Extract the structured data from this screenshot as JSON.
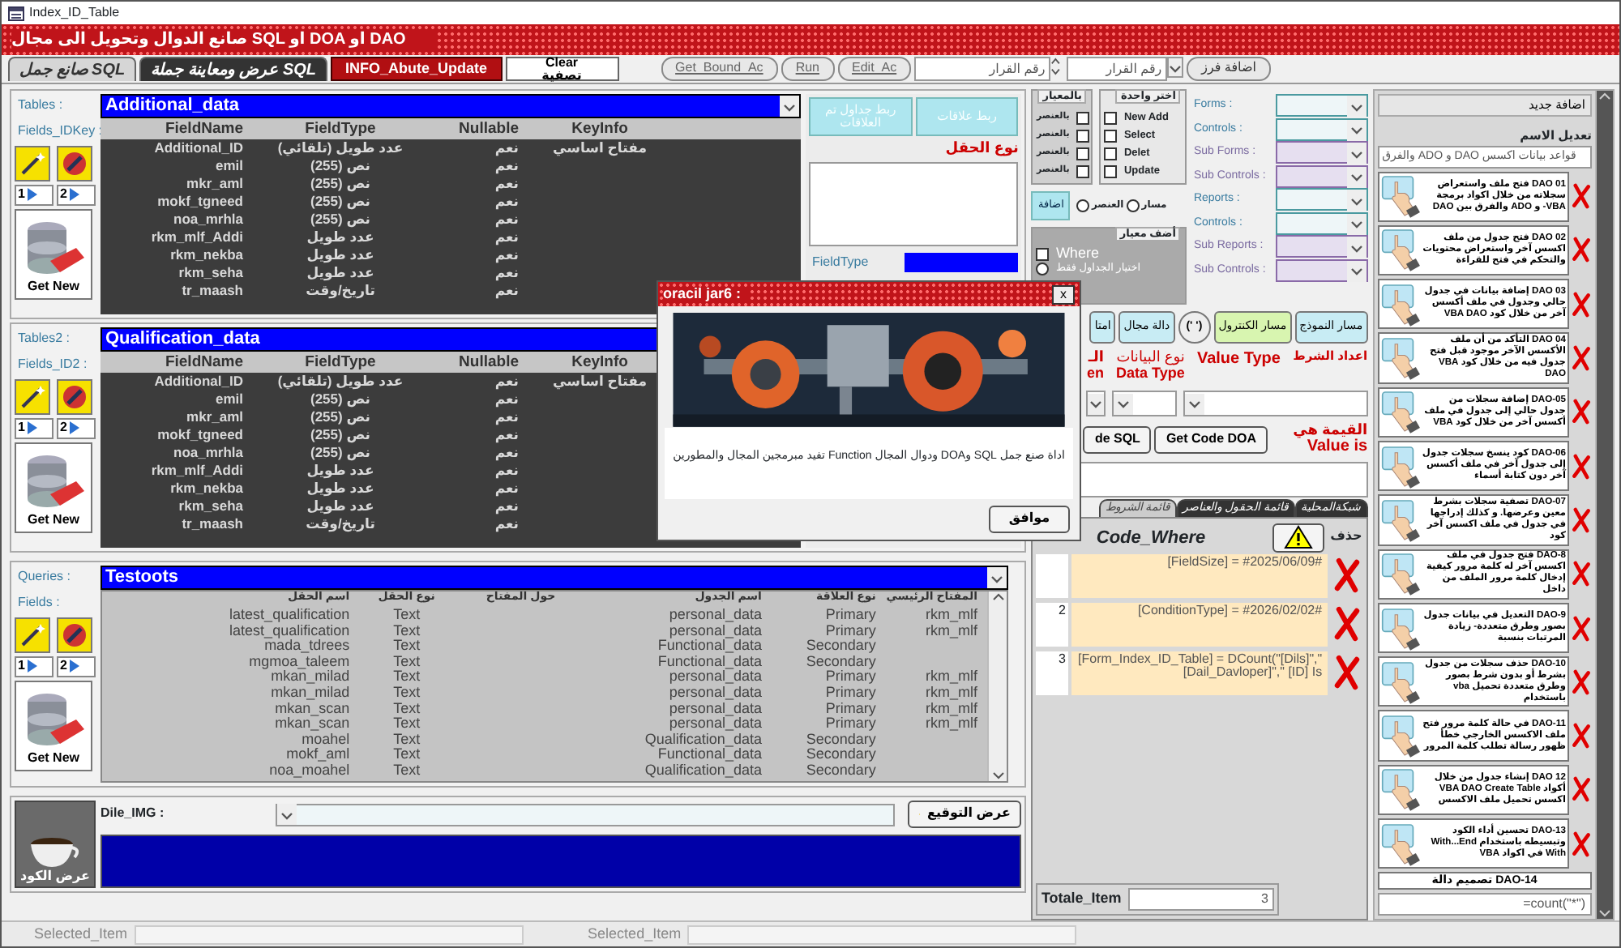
{
  "window": {
    "title": "Index_ID_Table"
  },
  "banner": {
    "title": "صانع الدوال وتحويل الى مجال SQL او DOA او DAO"
  },
  "toolbar": {
    "tabs": [
      {
        "label": "عرض ومعاينة جملة SQL",
        "selected": false
      },
      {
        "label": "صانع جمل SQL",
        "selected": true
      }
    ],
    "info_button": "INFO_Abute_Update",
    "clear_button": {
      "line_1": "Clear",
      "line_2": "تصفية"
    },
    "action_buttons": [
      "Edit_Ac",
      "Run",
      "Get_Bound_Ac"
    ],
    "number_spinner": {
      "placeholder": "رقم القرار"
    },
    "number_combo": {
      "placeholder": "رقم القرار"
    },
    "sort_button": "اضافة فرز"
  },
  "table_panels": [
    {
      "tables_label": "Tables :",
      "fields_label": "Fields_IDKey :",
      "table": "Additional_data",
      "columns": [
        "KeyInfo",
        "Nullable",
        "FieldType",
        "FieldName"
      ],
      "nav_buttons": [
        "2",
        "1"
      ],
      "get_new_button": "Get New",
      "rows": [
        {
          "key_info": "مفتاح اساسي",
          "nullable": "نعم",
          "field_type": "عدد طويل (تلقائي)",
          "field_name": "Additional_ID"
        },
        {
          "nullable": "نعم",
          "field_type": "نص (255)",
          "field_name": "emil"
        },
        {
          "nullable": "نعم",
          "field_type": "نص (255)",
          "field_name": "mkr_aml"
        },
        {
          "nullable": "نعم",
          "field_type": "نص (255)",
          "field_name": "mokf_tgneed"
        },
        {
          "nullable": "نعم",
          "field_type": "نص (255)",
          "field_name": "noa_mrhla"
        },
        {
          "nullable": "نعم",
          "field_type": "عدد طويل",
          "field_name": "rkm_mlf_Addi"
        },
        {
          "nullable": "نعم",
          "field_type": "عدد طويل",
          "field_name": "rkm_nekba"
        },
        {
          "nullable": "نعم",
          "field_type": "عدد طويل",
          "field_name": "rkm_seha"
        },
        {
          "nullable": "نعم",
          "field_type": "تاريخ/وقت",
          "field_name": "tr_maash"
        }
      ]
    },
    {
      "tables_label": "Tables2 :",
      "fields_label": "Fields_ID2 :",
      "table": "Qualification_data",
      "columns": [
        "KeyInfo",
        "Nullable",
        "FieldType",
        "FieldName"
      ],
      "nav_buttons": [
        "2",
        "1"
      ],
      "get_new_button": "Get New",
      "rows": [
        {
          "key_info": "مفتاح اساسي",
          "nullable": "نعم",
          "field_type": "عدد طويل (تلقائي)",
          "field_name": "Additional_ID"
        },
        {
          "nullable": "نعم",
          "field_type": "نص (255)",
          "field_name": "emil"
        },
        {
          "nullable": "نعم",
          "field_type": "نص (255)",
          "field_name": "mkr_aml"
        },
        {
          "nullable": "نعم",
          "field_type": "نص (255)",
          "field_name": "mokf_tgneed"
        },
        {
          "nullable": "نعم",
          "field_type": "نص (255)",
          "field_name": "noa_mrhla"
        },
        {
          "nullable": "نعم",
          "field_type": "عدد طويل",
          "field_name": "rkm_mlf_Addi"
        },
        {
          "nullable": "نعم",
          "field_type": "عدد طويل",
          "field_name": "rkm_nekba"
        },
        {
          "nullable": "نعم",
          "field_type": "عدد طويل",
          "field_name": "rkm_seha"
        },
        {
          "nullable": "نعم",
          "field_type": "تاريخ/وقت",
          "field_name": "tr_maash"
        }
      ]
    }
  ],
  "relations": {
    "buttons": [
      {
        "label": "ربط علاقات",
        "disabled": true
      },
      {
        "label": "ربط جداول تم العلاقات",
        "disabled": true
      }
    ],
    "field_type_title": "نوع الحقل",
    "field_type_label": "FieldType"
  },
  "query_panel": {
    "queries_label": "Queries :",
    "fields_label": "Fields :",
    "query": "Testoots",
    "nav_buttons": [
      "2",
      "1"
    ],
    "get_new_button": "Get New",
    "columns": [
      "المفتاح الرئيسي",
      "نوع العلاقة",
      "اسم الجدول",
      "حول المفتاح",
      "نوع الحقل",
      "اسم الحقل"
    ],
    "rows": [
      {
        "primary_key": "rkm_mlf",
        "relation": "Primary",
        "table_name": "personal_data",
        "field_type": "Text",
        "field_name": "latest_qualification"
      },
      {
        "primary_key": "rkm_mlf",
        "relation": "Primary",
        "table_name": "personal_data",
        "field_type": "Text",
        "field_name": "latest_qualification"
      },
      {
        "relation": "Secondary",
        "table_name": "Functional_data",
        "field_type": "Text",
        "field_name": "mada_tdrees"
      },
      {
        "relation": "Secondary",
        "table_name": "Functional_data",
        "field_type": "Text",
        "field_name": "mgmoa_taleem"
      },
      {
        "primary_key": "rkm_mlf",
        "relation": "Primary",
        "table_name": "personal_data",
        "field_type": "Text",
        "field_name": "mkan_milad"
      },
      {
        "primary_key": "rkm_mlf",
        "relation": "Primary",
        "table_name": "personal_data",
        "field_type": "Text",
        "field_name": "mkan_milad"
      },
      {
        "primary_key": "rkm_mlf",
        "relation": "Primary",
        "table_name": "personal_data",
        "field_type": "Text",
        "field_name": "mkan_scan"
      },
      {
        "primary_key": "rkm_mlf",
        "relation": "Primary",
        "table_name": "personal_data",
        "field_type": "Text",
        "field_name": "mkan_scan"
      },
      {
        "relation": "Secondary",
        "table_name": "Qualification_data",
        "field_type": "Text",
        "field_name": "moahel"
      },
      {
        "relation": "Secondary",
        "table_name": "Functional_data",
        "field_type": "Text",
        "field_name": "mokf_aml"
      },
      {
        "relation": "Secondary",
        "table_name": "Qualification_data",
        "field_type": "Text",
        "field_name": "noa_moahel"
      }
    ]
  },
  "image_panel": {
    "label": "Dile_IMG :",
    "show_signature_button": "عرض التوقيع",
    "show_code_button": "عرض الكود"
  },
  "criteria": {
    "by_criteria_title": "بالمعيار",
    "by_criteria": [
      {
        "label": "بالعنصر",
        "checked": false
      },
      {
        "label": "بالعنصر",
        "checked": false
      },
      {
        "label": "بالعنصر",
        "checked": false
      },
      {
        "label": "بالعنصر",
        "checked": false
      }
    ],
    "choose_one_title": "اختر واحدة",
    "choose_one": [
      {
        "label": "New Add",
        "checked": false
      },
      {
        "label": "Select",
        "checked": false
      },
      {
        "label": "Delet",
        "checked": false
      },
      {
        "label": "Update",
        "checked": false
      }
    ],
    "path_options": [
      {
        "label": "مسار",
        "selected": false
      },
      {
        "label": "العنصر",
        "selected": false
      }
    ],
    "add_button": "اضافة",
    "add_criteria_title": "أضف معيار",
    "where": {
      "label": "Where",
      "checked": false
    },
    "tables_only": {
      "label": "اختيار الجداول فقط",
      "selected": false
    }
  },
  "objects": [
    {
      "label": "Forms :",
      "kind": "main"
    },
    {
      "label": "Controls :",
      "kind": "main"
    },
    {
      "label": "Sub Forms :",
      "kind": "sub"
    },
    {
      "label": "Sub Controls :",
      "kind": "sub"
    },
    {
      "label": "Reports :",
      "kind": "main"
    },
    {
      "label": "Controls :",
      "kind": "main"
    },
    {
      "label": "Sub Reports :",
      "kind": "sub"
    },
    {
      "label": "Sub Controls :",
      "kind": "sub"
    }
  ],
  "function_buttons": [
    {
      "label": "مسار النموذج",
      "kind": "plain"
    },
    {
      "label": "مسار الكنترول",
      "kind": "green"
    },
    {
      "label": "(' ')",
      "kind": "round"
    },
    {
      "label": "دالة مجال",
      "kind": "plain"
    },
    {
      "label": "امتا",
      "kind": "plain"
    }
  ],
  "condition": {
    "cut_label": "الـ",
    "cut_label_2": "en",
    "data_type": {
      "line_1": "نوع البيانات",
      "line_2": "Data Type"
    },
    "value_type": "Value Type",
    "setup": "اعداد الشرط",
    "value_is": {
      "line_1": "القيمة هي",
      "line_2": "Value is"
    },
    "code_buttons": [
      "Get Code DOA",
      "de SQL"
    ]
  },
  "bottom_tabs": [
    {
      "label": "شبكةالمحلية",
      "selected": false
    },
    {
      "label": "قائمة الحقول والعناصر",
      "selected": false
    },
    {
      "label": "قائمة الشروط",
      "selected": true
    }
  ],
  "conditions": {
    "title": "Code_Where",
    "delete_label": "حذف",
    "rows": [
      {
        "code": "[FieldSize] = #2025/06/09#"
      },
      {
        "number": "2",
        "code": "[ConditionType] = #2026/02/02#"
      },
      {
        "number": "3",
        "code": "[Form_Index_ID_Table] = DCount(\"[Dils]\",\"[Dail_Davloper]\",\" [ID] Is"
      }
    ],
    "total_label": "Totale_Item",
    "total": "3"
  },
  "lessons": {
    "add_button": "اضافة جديد",
    "rename_label": "تعديل الاسم",
    "name_field": "قواعد بيانات اكسس DAO و ADO والفرق",
    "count_field": "=count(\"*\")",
    "items": [
      "DAO 01 فتح ملف واستعراض سجلاته من خلال اكواد برمجة VBA- و ADO والفرق بين DAO",
      "DAO 02 فتح جدول من ملف اكسس آخر واستعراض محتويات والتحكم في فتح للقراءة",
      "DAO 03 إضافة بيانات في جدول حالي وجدول في ملف أكسس آخر من خلال كود VBA DAO",
      "DAO 04 التأكد من أن ملف الأكسس الآخر موجود قبل فتح جدول فيه من خلال كود VBA DAO",
      "DAO-05 إضافة سجلات من جدول حالي إلى جدول في ملف أكسس آخر من خلال كود VBA",
      "DAO-06 كود ينسخ سجلات جدول إلى جدول آخر في ملف أكسس آخر دون كتابة أسماء",
      "DAO-07 تصفية سجلات بشرط معين وعرضها. و كذلك إدراجها في جدول في ملف اكسس آخر كود",
      "DAO-8 فتح جدول في ملف اكسس آخر له كلمة مرور كيفية إدخال كلمة مرور الملف من داخل",
      "DAO-9 التعديل في بيانات جدول بصور وطرق متعددة- زيادة المرتبات بنسبة",
      "DAO-10 حذف سجلات من جدول بشرط أو بدون شرط بصور وطرق متعددة تحميل vba باستخدام",
      "DAO-11 في حالة كلمة مرور فتح ملف الاكسس الخارجي خطأ ظهور رسالة تطلب كلمة المرور",
      "DAO 12 إنشاء جدول من خلال أكواد VBA DAO Create Table اكسس تحميل ملف الاكسس",
      "DAO-13 تحسين أداء الكود وتبسيطه باستخدام With...End With في اكواد VBA",
      "DAO-14 تصميم دالة"
    ]
  },
  "dialog": {
    "title": "oracil jar6 :",
    "close": "x",
    "message": "اداة صنع جمل SQL وDOA ودوال المجال Function تفيد مبرمجين المجال والمطورين",
    "ok_button": "موافق"
  },
  "status_bar": [
    {
      "label": "Selected_Item"
    },
    {
      "label": "Selected_Item"
    }
  ]
}
